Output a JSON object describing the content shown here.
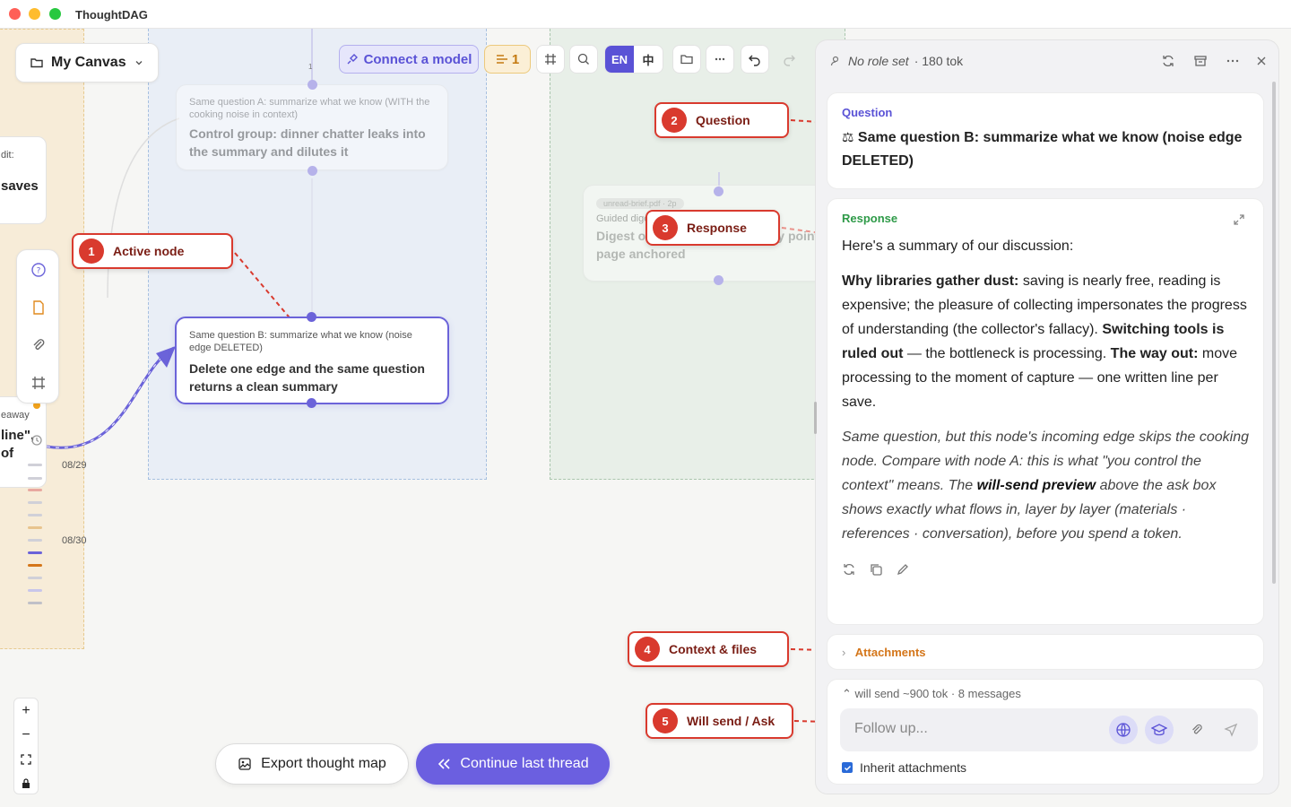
{
  "app": {
    "name": "ThoughtDAG"
  },
  "canvas": {
    "title": "My Canvas",
    "left_card_top": {
      "line1": "dit:",
      "line2": "saves"
    },
    "left_card_bottom": {
      "line1": "eaway",
      "line2": "line\",",
      "line3": "of"
    },
    "timeline": {
      "date1": "08/29",
      "date2": "08/30"
    },
    "nodes": {
      "node_a": {
        "question": "Same question A: summarize what we know (WITH the cooking noise in context)",
        "title": "Control group: dinner chatter leaks into the summary and dilutes it",
        "port_label": "1"
      },
      "node_b": {
        "question": "Same question B: summarize what we know (noise edge DELETED)",
        "title": "Delete one edge and the same question returns a clean summary"
      },
      "node_c": {
        "tag": "unread-brief.pdf · 2p",
        "subtitle": "Guided digest: unread-brief.pdf",
        "title": "Digest of ... processing ... every point page anchored"
      }
    }
  },
  "toolbar": {
    "connect_label": "Connect a model",
    "count_label": "1",
    "lang_en": "EN",
    "lang_zh": "中"
  },
  "callouts": [
    {
      "num": "1",
      "label": "Active node"
    },
    {
      "num": "2",
      "label": "Question"
    },
    {
      "num": "3",
      "label": "Response"
    },
    {
      "num": "4",
      "label": "Context & files"
    },
    {
      "num": "5",
      "label": "Will send / Ask"
    }
  ],
  "buttons": {
    "export": "Export thought map",
    "continue": "Continue last thread"
  },
  "panel": {
    "role": "No role set",
    "tokens": "· 180 tok",
    "question_label": "Question",
    "question": "Same question B: summarize what we know (noise edge DELETED)",
    "response_label": "Response",
    "response": {
      "intro": "Here's a summary of our discussion:",
      "p1_bold": "Why libraries gather dust:",
      "p1_text": " saving is nearly free, reading is expensive; the pleasure of collecting impersonates the progress of understanding (the collector's fallacy).",
      "p2_bold": "Switching tools is ruled out",
      "p2_text": " — the bottleneck is processing.",
      "p3_bold": "The way out:",
      "p3_text": " move processing to the moment of capture — one written line per save.",
      "italic_a": "Same question, but this node's incoming edge skips the cooking node. Compare with node A: this is what \"you control the context\" means. The ",
      "italic_bold": "will-send preview",
      "italic_b": " above the ask box shows exactly what flows in, layer by layer (materials · references · conversation), before you spend a token."
    },
    "attachments_label": "Attachments",
    "will_send": "will send ~900 tok · 8 messages",
    "input_placeholder": "Follow up...",
    "inherit_label": "Inherit attachments"
  },
  "colors": {
    "accent": "#6b63d9",
    "callout": "#d93a2e",
    "question_label": "#5a52d6",
    "response_label": "#2e9a48",
    "attachments": "#d4761a"
  }
}
